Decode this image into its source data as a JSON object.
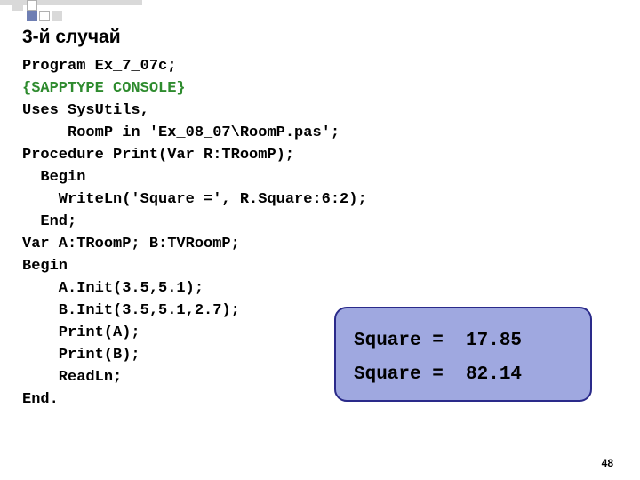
{
  "title": "3-й случай",
  "code": {
    "l1": "Program Ex_7_07c;",
    "l2": "{$APPTYPE CONSOLE}",
    "l3": "Uses SysUtils,",
    "l4": "     RoomP in 'Ex_08_07\\RoomP.pas';",
    "l5": "Procedure Print(Var R:TRoomP);",
    "l6": "  Begin",
    "l7": "    WriteLn('Square =', R.Square:6:2);",
    "l8": "  End;",
    "l9": "Var A:TRoomP; B:TVRoomP;",
    "l10": "Begin",
    "l11": "    A.Init(3.5,5.1);",
    "l12": "    B.Init(3.5,5.1,2.7);",
    "l13": "    Print(A);",
    "l14": "    Print(B);",
    "l15": "    ReadLn;",
    "l16": "End."
  },
  "output": {
    "line1": "Square =  17.85",
    "line2": "Square =  82.14"
  },
  "page_number": "48"
}
